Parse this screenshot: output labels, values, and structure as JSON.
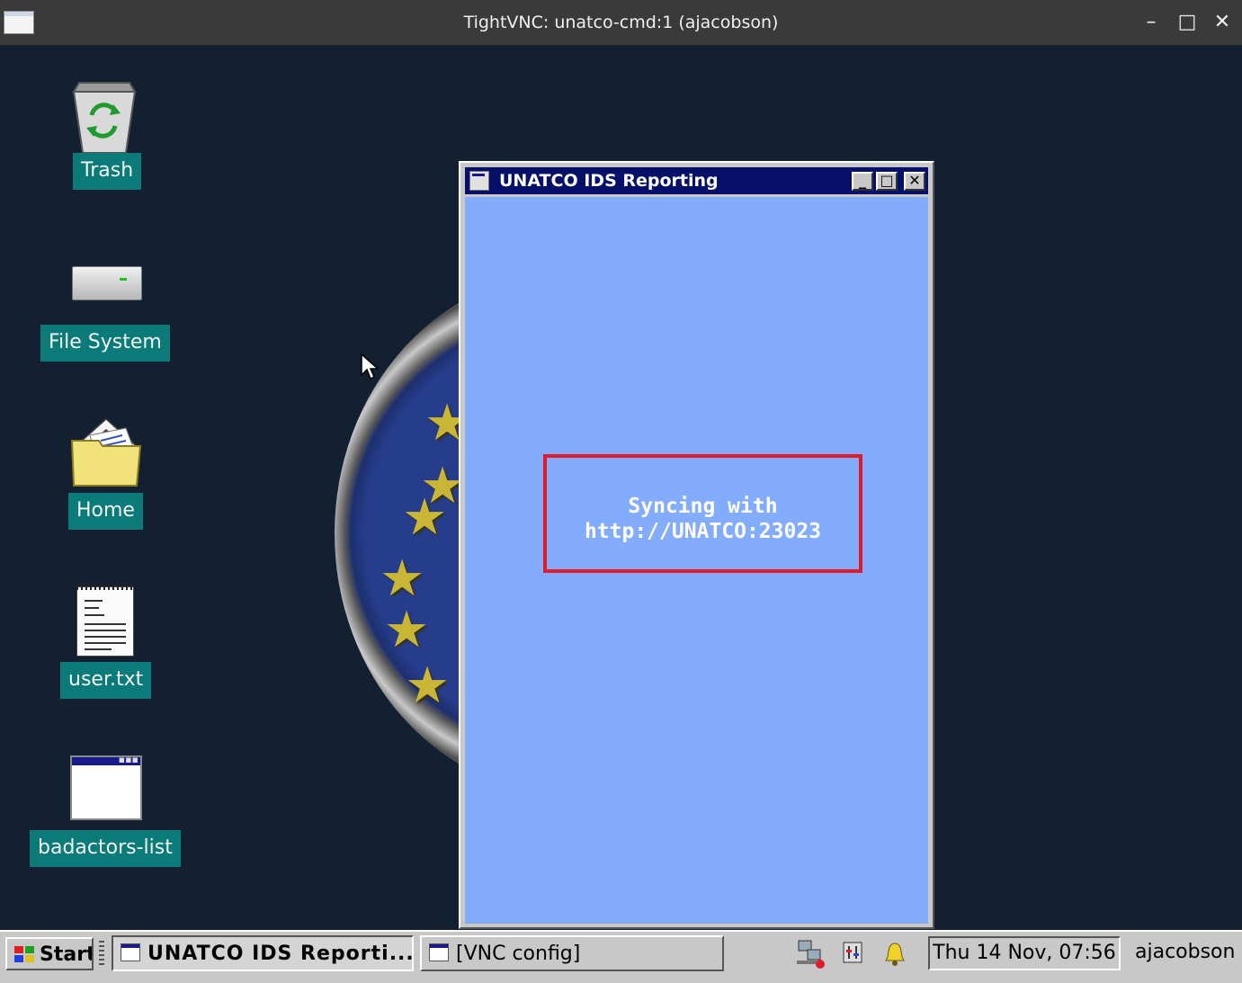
{
  "window": {
    "title": "TightVNC: unatco-cmd:1 (ajacobson)",
    "controls": {
      "minimize": "–",
      "maximize": "□",
      "close": "✕"
    }
  },
  "desktop": {
    "background": "#122031",
    "icons": [
      {
        "label": "Trash",
        "icon": "trash-icon"
      },
      {
        "label": "File System",
        "icon": "filesystem-icon"
      },
      {
        "label": "Home",
        "icon": "home-folder-icon"
      },
      {
        "label": "user.txt",
        "icon": "text-file-icon"
      },
      {
        "label": "badactors-list",
        "icon": "window-icon"
      }
    ]
  },
  "dialog": {
    "title": "UNATCO IDS Reporting",
    "controls": {
      "minimize": "_",
      "maximize": "□",
      "close": "✕"
    },
    "body_color": "#84acfc",
    "status_line1": "Syncing with",
    "status_line2": "http://UNATCO:23023",
    "highlight_color": "#e01b2a"
  },
  "taskbar": {
    "start_label": "Start",
    "tasks": [
      {
        "label": "UNATCO IDS Reporti...",
        "active": true
      },
      {
        "label": "[VNC config]",
        "active": false
      }
    ],
    "tray_icons": [
      "network-icon",
      "mixer-icon",
      "bell-icon"
    ],
    "clock": "Thu 14 Nov, 07:56",
    "user": "ajacobson"
  }
}
